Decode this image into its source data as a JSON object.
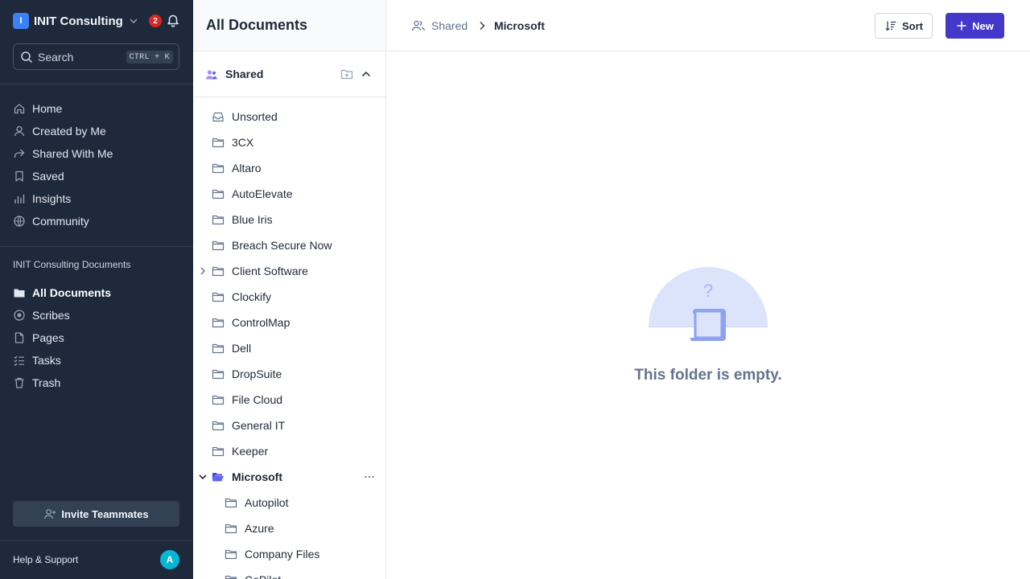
{
  "workspace": {
    "logo_letter": "I",
    "name": "INIT Consulting",
    "notification_count": "2"
  },
  "search": {
    "label": "Search",
    "shortcut": "CTRL + K"
  },
  "nav": {
    "primary": [
      {
        "label": "Home",
        "icon": "home-icon"
      },
      {
        "label": "Created by Me",
        "icon": "user-icon"
      },
      {
        "label": "Shared With Me",
        "icon": "share-icon"
      },
      {
        "label": "Saved",
        "icon": "bookmark-icon"
      },
      {
        "label": "Insights",
        "icon": "bar-chart-icon"
      },
      {
        "label": "Community",
        "icon": "globe-icon"
      }
    ],
    "section_label": "INIT Consulting Documents",
    "documents": [
      {
        "label": "All Documents",
        "icon": "folder-icon",
        "active": true
      },
      {
        "label": "Scribes",
        "icon": "record-icon"
      },
      {
        "label": "Pages",
        "icon": "page-icon"
      },
      {
        "label": "Tasks",
        "icon": "checklist-icon"
      },
      {
        "label": "Trash",
        "icon": "trash-icon"
      }
    ]
  },
  "footer": {
    "invite_label": "Invite Teammates",
    "help_label": "Help & Support",
    "avatar_letter": "A"
  },
  "tree": {
    "title": "All Documents",
    "root_label": "Shared",
    "items": [
      {
        "label": "Unsorted",
        "icon": "inbox-icon"
      },
      {
        "label": "3CX",
        "icon": "folder-icon"
      },
      {
        "label": "Altaro",
        "icon": "folder-icon"
      },
      {
        "label": "AutoElevate",
        "icon": "folder-icon"
      },
      {
        "label": "Blue Iris",
        "icon": "folder-icon"
      },
      {
        "label": "Breach Secure Now",
        "icon": "folder-icon"
      },
      {
        "label": "Client Software",
        "icon": "folder-icon",
        "expandable": true
      },
      {
        "label": "Clockify",
        "icon": "folder-icon"
      },
      {
        "label": "ControlMap",
        "icon": "folder-icon"
      },
      {
        "label": "Dell",
        "icon": "folder-icon"
      },
      {
        "label": "DropSuite",
        "icon": "folder-icon"
      },
      {
        "label": "File Cloud",
        "icon": "folder-icon"
      },
      {
        "label": "General IT",
        "icon": "folder-icon"
      },
      {
        "label": "Keeper",
        "icon": "folder-icon"
      },
      {
        "label": "Microsoft",
        "icon": "folder-open-icon",
        "expanded": true,
        "selected": true
      },
      {
        "label": "Autopilot",
        "icon": "folder-icon",
        "child": true
      },
      {
        "label": "Azure",
        "icon": "folder-icon",
        "child": true
      },
      {
        "label": "Company Files",
        "icon": "folder-icon",
        "child": true
      },
      {
        "label": "CoPilot",
        "icon": "folder-icon",
        "child": true
      }
    ]
  },
  "main": {
    "breadcrumb_root": "Shared",
    "breadcrumb_current": "Microsoft",
    "sort_label": "Sort",
    "new_label": "New",
    "empty_message": "This folder is empty."
  },
  "colors": {
    "sidebar_bg": "#1e293b",
    "accent": "#4338ca",
    "badge": "#dc2626",
    "avatar": "#06b6d4",
    "illustration": "#dbe4fb"
  }
}
